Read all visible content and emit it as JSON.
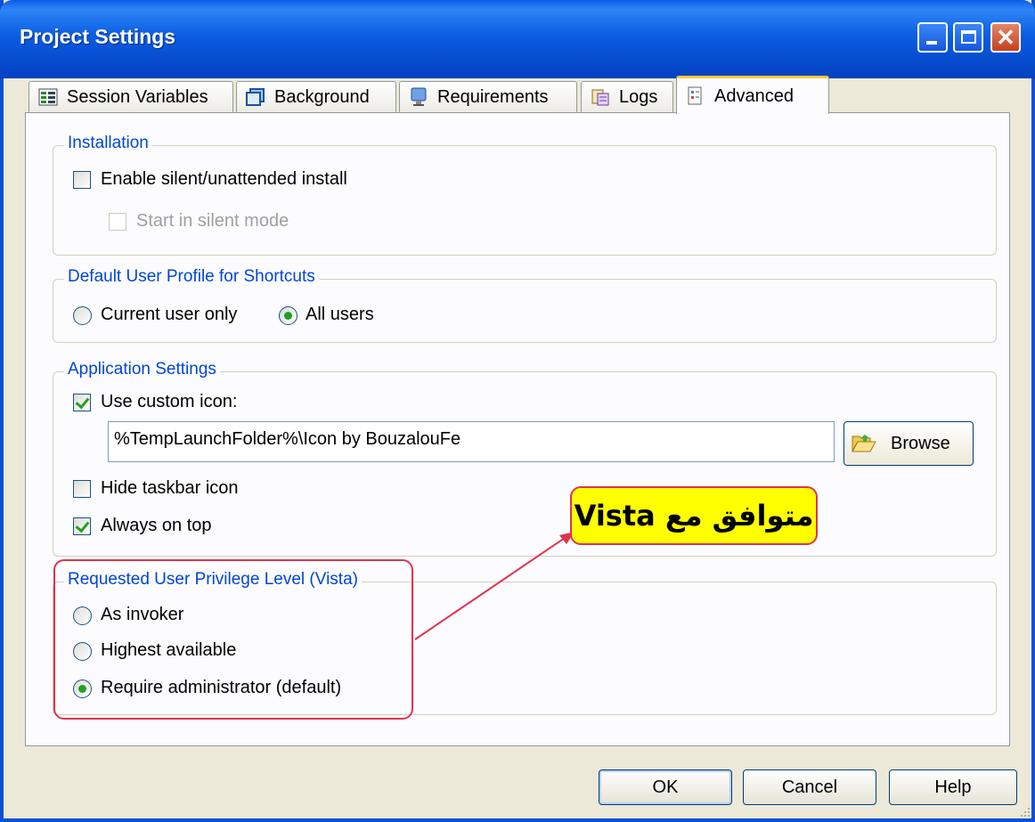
{
  "window": {
    "title": "Project Settings",
    "colors": {
      "title_bar": "#0a5ce6",
      "dialog_bg": "#ece9d8",
      "group_legend": "#0046d5",
      "annotation_border": "#e0334f",
      "annotation_fill": "#ffff00"
    }
  },
  "tabs": [
    {
      "label": "Session Variables",
      "icon": "session-variables-icon"
    },
    {
      "label": "Background",
      "icon": "background-icon"
    },
    {
      "label": "Requirements",
      "icon": "requirements-icon"
    },
    {
      "label": "Logs",
      "icon": "logs-icon"
    },
    {
      "label": "Advanced",
      "icon": "advanced-icon",
      "active": true
    }
  ],
  "installation": {
    "legend": "Installation",
    "enable_silent": {
      "label": "Enable silent/unattended install",
      "checked": false
    },
    "start_silent": {
      "label": "Start in silent mode",
      "checked": false,
      "disabled": true
    }
  },
  "profile": {
    "legend": "Default User Profile for Shortcuts",
    "current_user": {
      "label": "Current user only",
      "selected": false
    },
    "all_users": {
      "label": "All users",
      "selected": true
    }
  },
  "app_settings": {
    "legend": "Application Settings",
    "use_custom_icon": {
      "label": "Use custom icon:",
      "checked": true
    },
    "icon_path": "%TempLaunchFolder%\\Icon by BouzalouFe",
    "browse_label": "Browse",
    "hide_taskbar": {
      "label": "Hide taskbar icon",
      "checked": false
    },
    "always_on_top": {
      "label": "Always on top",
      "checked": true
    }
  },
  "privilege": {
    "legend": "Requested User Privilege Level (Vista)",
    "as_invoker": {
      "label": "As invoker",
      "selected": false
    },
    "highest": {
      "label": "Highest available",
      "selected": false
    },
    "require_admin": {
      "label": "Require administrator (default)",
      "selected": true
    }
  },
  "annotation": {
    "text": "متوافق مع Vista"
  },
  "buttons": {
    "ok": "OK",
    "cancel": "Cancel",
    "help": "Help"
  }
}
